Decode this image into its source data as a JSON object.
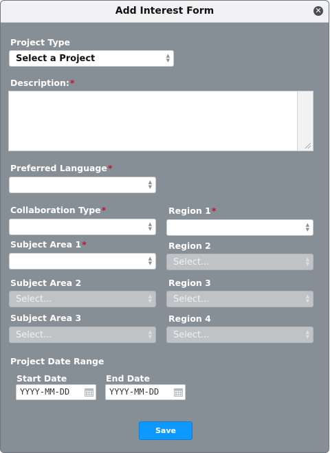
{
  "dialog": {
    "title": "Add Interest Form",
    "close_icon": "close-circle-icon"
  },
  "fields": {
    "project_type": {
      "label": "Project Type",
      "value": "Select a Project"
    },
    "description": {
      "label": "Description:",
      "required": "*",
      "value": ""
    },
    "preferred_language": {
      "label": "Preferred Language",
      "required": "*",
      "value": ""
    },
    "collaboration_type": {
      "label": "Collaboration Type",
      "required": "*",
      "value": ""
    },
    "region_1": {
      "label": "Region 1",
      "required": "*",
      "value": ""
    },
    "subject_area_1": {
      "label": "Subject Area 1",
      "required": "*",
      "value": ""
    },
    "region_2": {
      "label": "Region 2",
      "value": "Select..."
    },
    "subject_area_2": {
      "label": "Subject Area 2",
      "value": "Select..."
    },
    "region_3": {
      "label": "Region 3",
      "value": "Select..."
    },
    "subject_area_3": {
      "label": "Subject Area 3",
      "value": "Select..."
    },
    "region_4": {
      "label": "Region 4",
      "value": "Select..."
    }
  },
  "date_range": {
    "label": "Project Date Range",
    "start": {
      "label": "Start Date",
      "placeholder": "YYYY-MM-DD"
    },
    "end": {
      "label": "End Date",
      "placeholder": "YYYY-MM-DD"
    }
  },
  "actions": {
    "save_label": "Save"
  },
  "colors": {
    "accent": "#0d99ff",
    "required": "#c8102e",
    "panel": "#868e96"
  }
}
